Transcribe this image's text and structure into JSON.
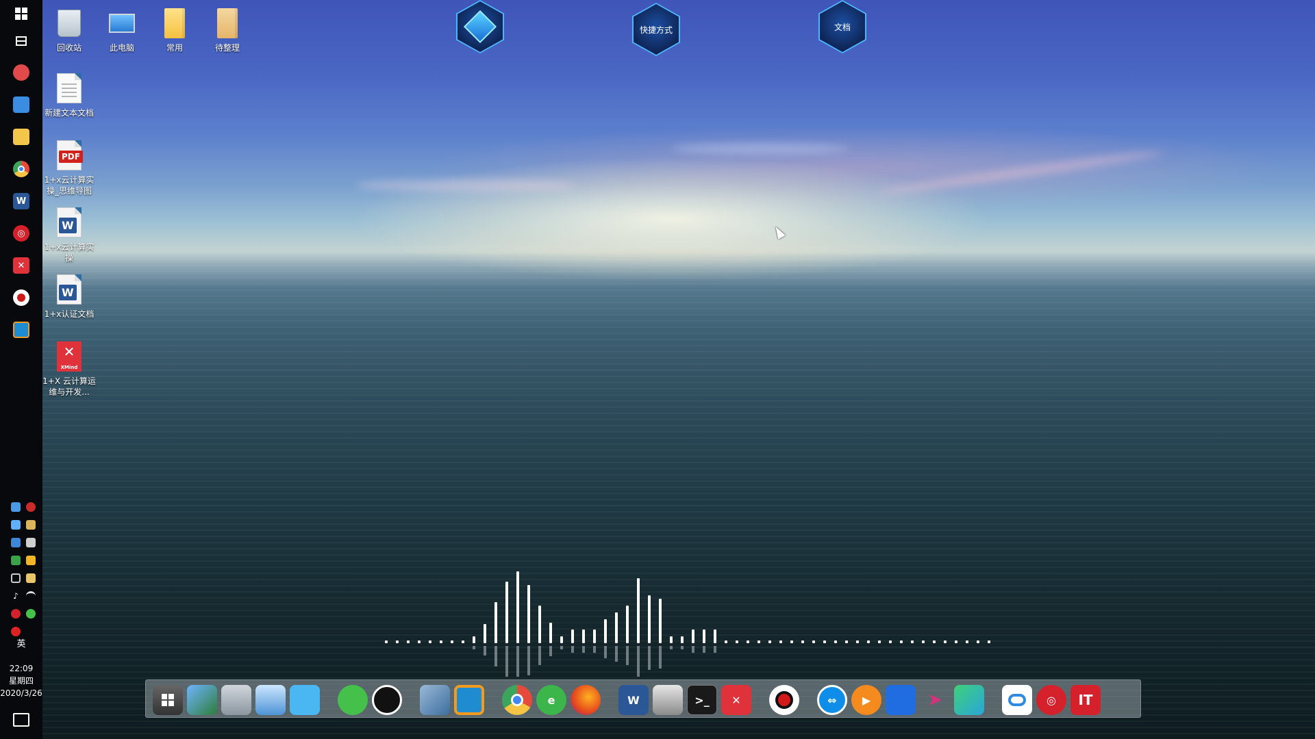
{
  "desktop": {
    "icons": [
      {
        "label": "回收站"
      },
      {
        "label": "此电脑"
      },
      {
        "label": "常用"
      },
      {
        "label": "待整理"
      },
      {
        "label": "新建文本文档"
      },
      {
        "label": "1+x云计算实操_思维导图",
        "badge": "PDF"
      },
      {
        "label": "1+x云计算实操",
        "badge": "W"
      },
      {
        "label": "1+x认证文档",
        "badge": "W"
      },
      {
        "label": "1+X 云计算运维与开发...",
        "badge": "XMind"
      }
    ],
    "hex_widgets": [
      {
        "label": ""
      },
      {
        "label": "快捷方式"
      },
      {
        "label": "文档"
      }
    ]
  },
  "left_taskbar": {
    "language": "英",
    "clock": {
      "time": "22:09",
      "weekday": "星期四",
      "date": "2020/3/26"
    },
    "pinned": [
      {
        "icon": "windows-logo-icon"
      },
      {
        "icon": "task-view-icon"
      },
      {
        "icon": "paint-app-icon"
      },
      {
        "icon": "computer-app-icon"
      },
      {
        "icon": "file-explorer-icon"
      },
      {
        "icon": "chrome-icon"
      },
      {
        "icon": "word-icon"
      },
      {
        "icon": "netease-music-icon"
      },
      {
        "icon": "xmind-icon"
      },
      {
        "icon": "screen-recorder-icon"
      },
      {
        "icon": "virtual-machine-icon"
      }
    ]
  },
  "dock": {
    "items": [
      {
        "icon": "start-menu-icon"
      },
      {
        "icon": "network-globe-icon"
      },
      {
        "icon": "system-monitor-icon"
      },
      {
        "icon": "my-computer-icon"
      },
      {
        "icon": "cat-app-icon"
      },
      {
        "icon": "wechat-icon"
      },
      {
        "icon": "qq-icon"
      },
      {
        "icon": "network-tool-icon"
      },
      {
        "icon": "vmware-icon"
      },
      {
        "icon": "chrome-icon"
      },
      {
        "icon": "ie-browser-icon"
      },
      {
        "icon": "firefox-icon"
      },
      {
        "icon": "word-icon"
      },
      {
        "icon": "disk-manager-icon"
      },
      {
        "icon": "terminal-icon"
      },
      {
        "icon": "xmind-icon"
      },
      {
        "icon": "record-icon"
      },
      {
        "icon": "teamviewer-icon"
      },
      {
        "icon": "media-player-icon"
      },
      {
        "icon": "cloud-icon"
      },
      {
        "icon": "send-icon"
      },
      {
        "icon": "sublime-icon"
      },
      {
        "icon": "baidu-netdisk-icon"
      },
      {
        "icon": "netease-music-icon"
      },
      {
        "icon": "ithome-icon",
        "label": "IT"
      }
    ]
  },
  "colors": {
    "taskbar_bg": "#07090c",
    "hex_fill": "#0c1f4a",
    "hex_border": "#4db5ff",
    "visualizer": "#ffffff"
  }
}
